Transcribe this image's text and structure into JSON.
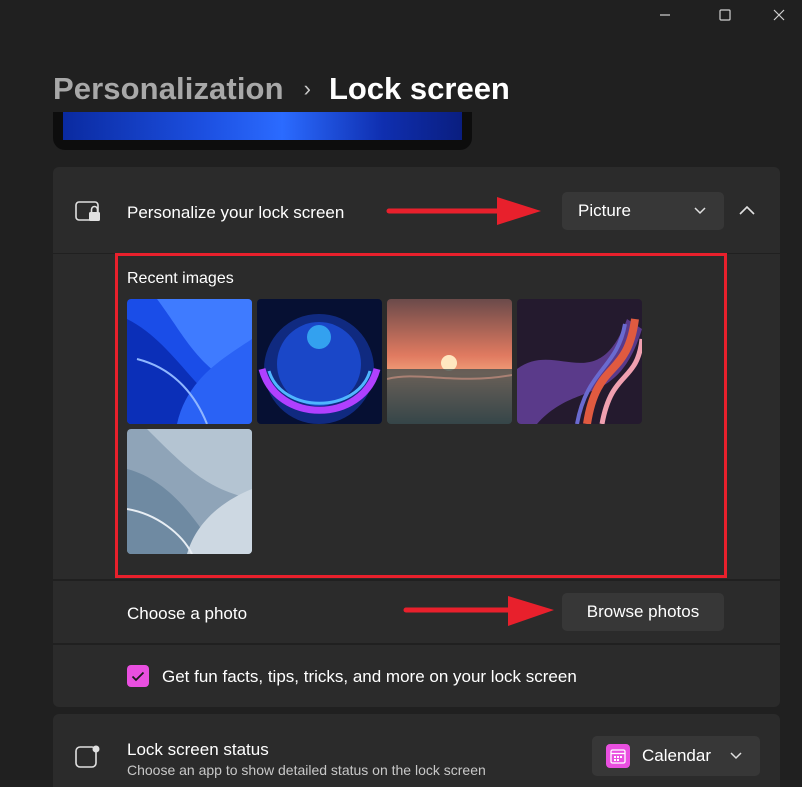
{
  "breadcrumb": {
    "parent": "Personalization",
    "separator": "›",
    "current": "Lock screen"
  },
  "window_controls": {
    "minimize": "minimize-icon",
    "maximize": "maximize-icon",
    "close": "close-icon"
  },
  "personalize": {
    "label": "Personalize your lock screen",
    "dropdown_value": "Picture",
    "icon": "lock-screen-icon"
  },
  "recent": {
    "title": "Recent images",
    "images": [
      {
        "name": "blue-bloom"
      },
      {
        "name": "blue-glow-orb"
      },
      {
        "name": "sunset-lake"
      },
      {
        "name": "purple-ribbon"
      },
      {
        "name": "gray-bloom"
      }
    ]
  },
  "photo": {
    "label": "Choose a photo",
    "button": "Browse photos"
  },
  "facts": {
    "label": "Get fun facts, tips, tricks, and more on your lock screen",
    "checked": true
  },
  "status": {
    "label": "Lock screen status",
    "sublabel": "Choose an app to show detailed status on the lock screen",
    "dropdown_value": "Calendar"
  },
  "colors": {
    "accent": "#e94fe0",
    "highlight": "#e8202c",
    "background": "#202020",
    "card": "#2b2b2b"
  }
}
